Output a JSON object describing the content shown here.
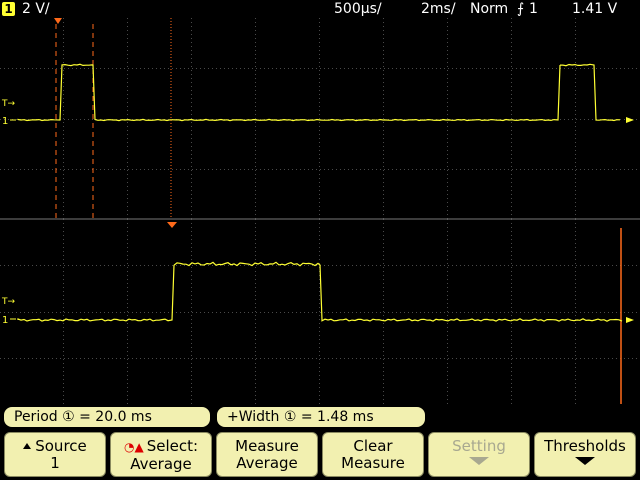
{
  "status_bar": {
    "channel_number": "1",
    "channel_scale": "2 V/",
    "timebase_main": "500µs/",
    "timebase_zoom": "2ms/",
    "trigger_mode": "Norm",
    "trigger_source": "1",
    "trigger_level": "1.41 V"
  },
  "measurements": {
    "period_label": "Period",
    "period_value": "= 20.0 ms",
    "width_label": "+Width",
    "width_value": "= 1.48 ms"
  },
  "softkeys": {
    "source": {
      "line1": "Source",
      "line2": "1"
    },
    "select": {
      "line1": "Select:",
      "line2": "Average"
    },
    "measure": {
      "line1": "Measure",
      "line2": "Average"
    },
    "clear": {
      "line1": "Clear",
      "line2": "Measure"
    },
    "setting": {
      "line1": "Setting"
    },
    "thresholds": {
      "line1": "Thresholds"
    }
  },
  "colors": {
    "trace": "#ffff33",
    "cursor": "#ff6a1a",
    "grid": "#5a5a5a",
    "softkey_bg": "#f2f0b0"
  },
  "icons": {
    "channel": "channel-1-badge",
    "trigger_edge": "rising-edge-icon",
    "source": "triangle-up-icon",
    "select": "select-knob-icon",
    "setting": "arrow-down-icon",
    "thresholds": "arrow-down-icon"
  }
}
